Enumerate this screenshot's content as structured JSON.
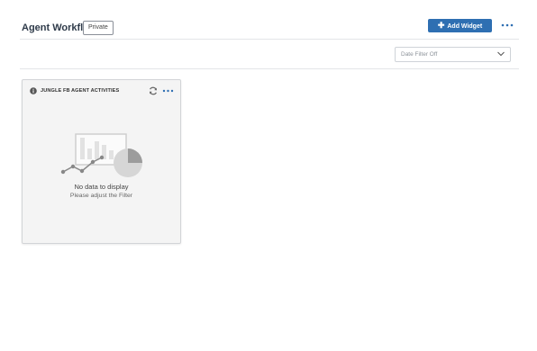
{
  "header": {
    "title": "Agent Workflow",
    "visibility_badge": "Private",
    "add_widget_label": "Add Widget",
    "accent_color": "#2e6fb2"
  },
  "filter": {
    "date_filter_value": "Date Filter Off"
  },
  "widget": {
    "title": "JUNGLE FB AGENT ACTIVITIES",
    "empty_title": "No data to display",
    "empty_subtitle": "Please adjust the Filter",
    "icons": [
      "info-icon",
      "refresh-icon",
      "more-options-icon"
    ]
  }
}
